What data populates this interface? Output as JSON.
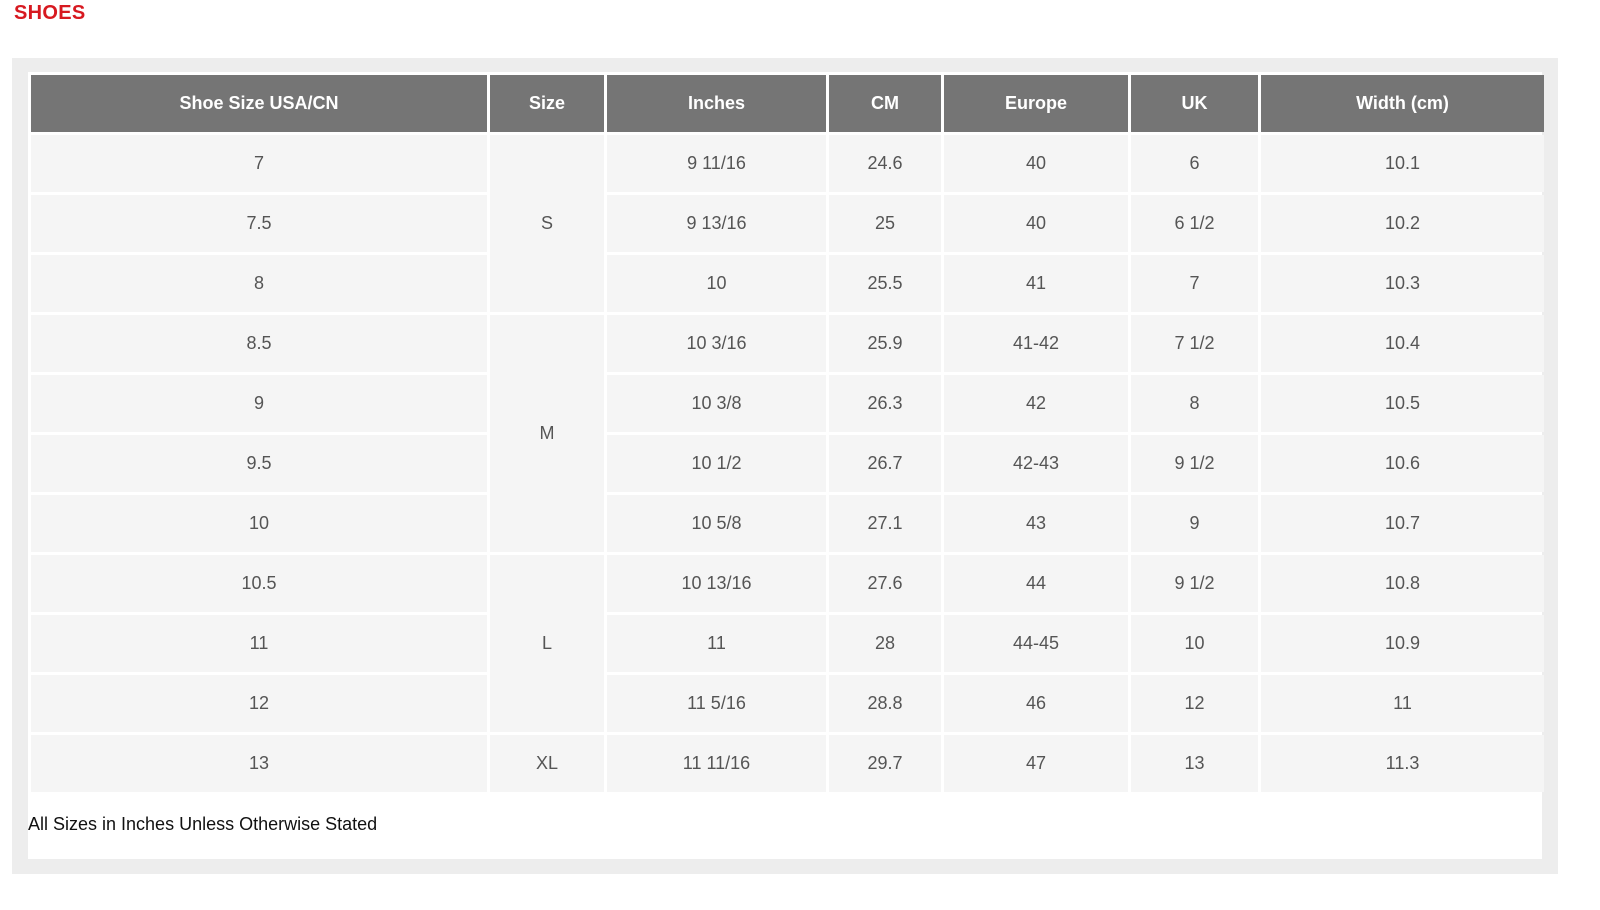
{
  "section_title": "SHOES",
  "headers": [
    "Shoe Size USA/CN",
    "Size",
    "Inches",
    "CM",
    "Europe",
    "UK",
    "Width (cm)"
  ],
  "size_groups": [
    {
      "label": "S",
      "rows": [
        {
          "us": "7",
          "inches": "9 11/16",
          "cm": "24.6",
          "europe": "40",
          "uk": "6",
          "width": "10.1"
        },
        {
          "us": "7.5",
          "inches": "9 13/16",
          "cm": "25",
          "europe": "40",
          "uk": "6 1/2",
          "width": "10.2"
        },
        {
          "us": "8",
          "inches": "10",
          "cm": "25.5",
          "europe": "41",
          "uk": "7",
          "width": "10.3"
        }
      ]
    },
    {
      "label": "M",
      "rows": [
        {
          "us": "8.5",
          "inches": "10 3/16",
          "cm": "25.9",
          "europe": "41-42",
          "uk": "7 1/2",
          "width": "10.4"
        },
        {
          "us": "9",
          "inches": "10 3/8",
          "cm": "26.3",
          "europe": "42",
          "uk": "8",
          "width": "10.5"
        },
        {
          "us": "9.5",
          "inches": "10 1/2",
          "cm": "26.7",
          "europe": "42-43",
          "uk": "9 1/2",
          "width": "10.6"
        },
        {
          "us": "10",
          "inches": "10 5/8",
          "cm": "27.1",
          "europe": "43",
          "uk": "9",
          "width": "10.7"
        }
      ]
    },
    {
      "label": "L",
      "rows": [
        {
          "us": "10.5",
          "inches": "10 13/16",
          "cm": "27.6",
          "europe": "44",
          "uk": "9 1/2",
          "width": "10.8"
        },
        {
          "us": "11",
          "inches": "11",
          "cm": "28",
          "europe": "44-45",
          "uk": "10",
          "width": "10.9"
        },
        {
          "us": "12",
          "inches": "11 5/16",
          "cm": "28.8",
          "europe": "46",
          "uk": "12",
          "width": "11"
        }
      ]
    },
    {
      "label": "XL",
      "rows": [
        {
          "us": "13",
          "inches": "11 11/16",
          "cm": "29.7",
          "europe": "47",
          "uk": "13",
          "width": "11.3"
        }
      ]
    }
  ],
  "footnote": "All Sizes in Inches Unless Otherwise Stated"
}
